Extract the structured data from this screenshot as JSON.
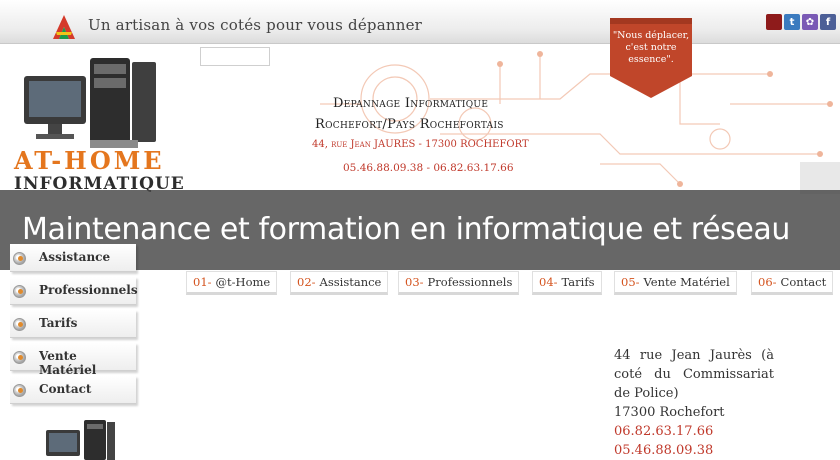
{
  "header": {
    "tagline": "Un artisan à vos cotés pour vous dépanner",
    "social": [
      {
        "name": "flag",
        "glyph": "",
        "color": "#9b1c1c"
      },
      {
        "name": "twitter",
        "glyph": "t",
        "color": "#3b7bbf"
      },
      {
        "name": "flickr",
        "glyph": "✿",
        "color": "#7a5ab5"
      },
      {
        "name": "facebook",
        "glyph": "f",
        "color": "#4c5f97"
      }
    ]
  },
  "brand": {
    "line1": "AT-HOME",
    "line2": "INFORMATIQUE"
  },
  "hero": {
    "title": "Depannage Informatique",
    "subtitle": "Rochefort/Pays Rochefortais",
    "address": "44, rue Jean JAURES - 17300 ROCHEFORT",
    "phones": "05.46.88.09.38 - 06.82.63.17.66",
    "ribbon": [
      "\"Nous déplacer,",
      "c'est notre",
      "essence\"."
    ]
  },
  "banner": {
    "text": "Maintenance et formation en informatique et réseau"
  },
  "sidebar": {
    "items": [
      {
        "label": "Assistance"
      },
      {
        "label": "Professionnels"
      },
      {
        "label": "Tarifs"
      },
      {
        "label": "Vente Matériel"
      },
      {
        "label": "Contact"
      }
    ]
  },
  "tabs": [
    {
      "num": "01-",
      "label": "@t-Home"
    },
    {
      "num": "02-",
      "label": "Assistance"
    },
    {
      "num": "03-",
      "label": "Professionnels"
    },
    {
      "num": "04-",
      "label": "Tarifs"
    },
    {
      "num": "05-",
      "label": "Vente Matériel"
    },
    {
      "num": "06-",
      "label": "Contact"
    }
  ],
  "contact_block": {
    "address": "44 rue Jean Jaurès (à coté du Commissariat de Police)",
    "city": "17300 Rochefort",
    "phone1": "06.82.63.17.66",
    "phone2": "05.46.88.09.38"
  },
  "colors": {
    "accent": "#d4541f",
    "brand_orange": "#e4761e",
    "link_red": "#c0392b",
    "banner": "#464646"
  }
}
